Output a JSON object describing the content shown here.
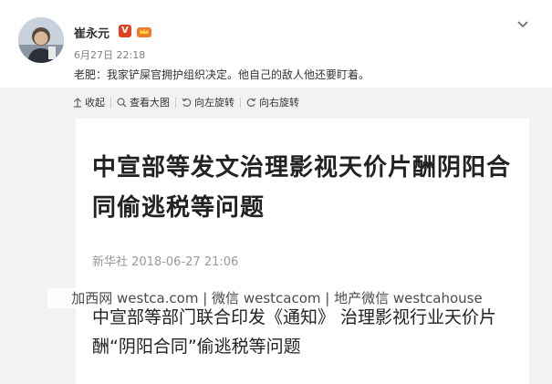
{
  "post": {
    "username": "崔永元",
    "verified_badge": "V",
    "timestamp": "6月27日 22:18",
    "text": "老肥：我家铲屎官拥护组织决定。他自己的敌人他还要盯着。",
    "accent": "#e14123"
  },
  "toolbar": {
    "collapse_label": "收起",
    "view_large_label": "查看大图",
    "rotate_left_label": "向左旋转",
    "rotate_right_label": "向右旋转"
  },
  "news": {
    "headline": "中宣部等发文治理影视天价片酬阴阳合同偷逃税等问题",
    "source": "新华社 2018-06-27 21:06",
    "body": "中宣部等部门联合印发《通知》 治理影视行业天价片酬“阴阳合同”偷逃税等问题"
  },
  "watermark": {
    "text": "加西网 westca.com | 微信 westcacom | 地产微信 westcahouse"
  }
}
